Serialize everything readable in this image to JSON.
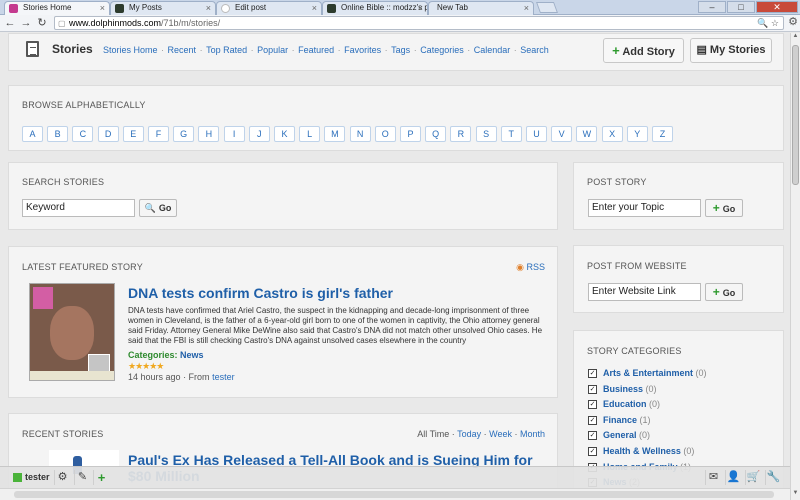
{
  "browser": {
    "tabs": [
      {
        "label": "Stories Home",
        "active": true
      },
      {
        "label": "My Posts",
        "active": false
      },
      {
        "label": "Edit post",
        "active": false
      },
      {
        "label": "Online Bible :: modzz's p",
        "active": false
      },
      {
        "label": "New Tab",
        "active": false
      }
    ],
    "url_host": "www.dolphinmods.com",
    "url_path": "/71b/m/stories/",
    "close_glyph": "×"
  },
  "header": {
    "title": "Stories",
    "nav": [
      "Stories Home",
      "Recent",
      "Top Rated",
      "Popular",
      "Featured",
      "Favorites",
      "Tags",
      "Categories",
      "Calendar",
      "Search"
    ],
    "add_story": "Add Story",
    "my_stories": "My Stories"
  },
  "alphabet": {
    "title": "BROWSE ALPHABETICALLY",
    "letters": [
      "A",
      "B",
      "C",
      "D",
      "E",
      "F",
      "G",
      "H",
      "I",
      "J",
      "K",
      "L",
      "M",
      "N",
      "O",
      "P",
      "Q",
      "R",
      "S",
      "T",
      "U",
      "V",
      "W",
      "X",
      "Y",
      "Z"
    ]
  },
  "search": {
    "title": "SEARCH STORIES",
    "value": "Keyword",
    "button": "Go"
  },
  "post_story": {
    "title": "POST STORY",
    "value": "Enter your Topic",
    "button": "Go"
  },
  "post_website": {
    "title": "POST FROM WEBSITE",
    "value": "Enter Website Link",
    "button": "Go"
  },
  "featured": {
    "title": "LATEST FEATURED STORY",
    "rss": "RSS",
    "headline": "DNA tests confirm Castro is girl's father",
    "body": "DNA tests have confirmed that Ariel Castro, the suspect in the kidnapping and decade-long imprisonment of three women in Cleveland, is the father of a 6-year-old girl born to one of the women in captivity, the Ohio attorney general said Friday. Attorney General Mike DeWine also said that Castro's DNA did not match other unsolved Ohio cases. He said that the FBI is still checking Castro's DNA against unsolved cases elsewhere in the country",
    "category_label": "Categories:",
    "category_value": "News",
    "rating": 5,
    "stars": "★★★★★",
    "time": "14 hours ago",
    "from_label": "· From",
    "author": "tester"
  },
  "recent": {
    "title": "RECENT STORIES",
    "filters": [
      "All Time",
      "Today",
      "Week",
      "Month"
    ],
    "headline": "Paul's Ex Has Released a Tell-All Book and is Sueing Him for $80 Million"
  },
  "categories": {
    "title": "STORY CATEGORIES",
    "items": [
      {
        "name": "Arts & Entertainment",
        "count": "(0)"
      },
      {
        "name": "Business",
        "count": "(0)"
      },
      {
        "name": "Education",
        "count": "(0)"
      },
      {
        "name": "Finance",
        "count": "(1)"
      },
      {
        "name": "General",
        "count": "(0)"
      },
      {
        "name": "Health & Wellness",
        "count": "(0)"
      },
      {
        "name": "Home and Family",
        "count": "(1)"
      },
      {
        "name": "News",
        "count": "(2)"
      }
    ]
  },
  "bottombar": {
    "username": "tester"
  },
  "colors": {
    "link": "#2a6ebb",
    "headline": "#1f5fa8",
    "accent_green": "#2e9a2e"
  }
}
